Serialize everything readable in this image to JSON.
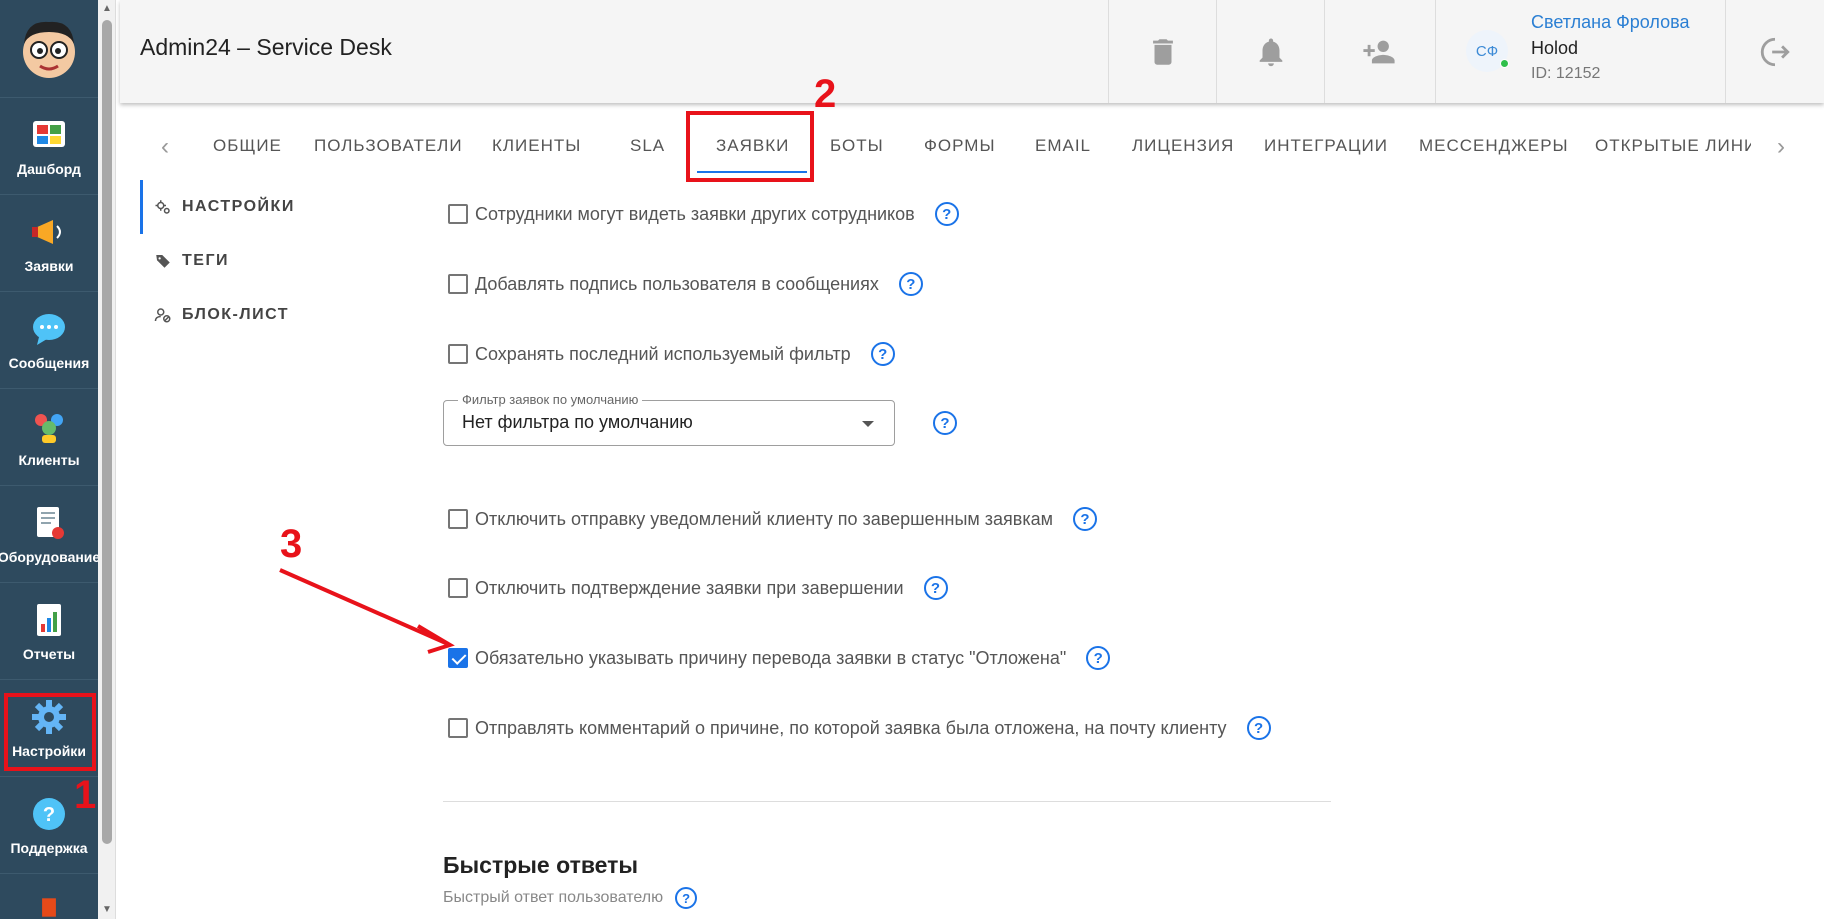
{
  "app": {
    "title": "Admin24 – Service Desk"
  },
  "leftnav": {
    "items": [
      {
        "label": "Дашборд",
        "icon": "dashboard-icon"
      },
      {
        "label": "Заявки",
        "icon": "megaphone-icon"
      },
      {
        "label": "Сообщения",
        "icon": "chat-bubble-icon"
      },
      {
        "label": "Клиенты",
        "icon": "clients-icon"
      },
      {
        "label": "Оборудование",
        "icon": "equipment-icon"
      },
      {
        "label": "Отчеты",
        "icon": "report-icon"
      },
      {
        "label": "Настройки",
        "icon": "gear-icon"
      },
      {
        "label": "Поддержка",
        "icon": "help-icon"
      }
    ],
    "active": "Настройки"
  },
  "header": {
    "user": {
      "initials": "СФ",
      "name": "Светлана Фролова",
      "company": "Holod",
      "id": "ID: 12152"
    },
    "buttons": [
      "trash-icon",
      "bell-icon",
      "add-user-icon",
      "logout-icon"
    ]
  },
  "tabs": {
    "items": [
      "ОБЩИЕ",
      "ПОЛЬЗОВАТЕЛИ",
      "КЛИЕНТЫ",
      "SLA",
      "ЗАЯВКИ",
      "БОТЫ",
      "ФОРМЫ",
      "EMAIL",
      "ЛИЦЕНЗИЯ",
      "ИНТЕГРАЦИИ",
      "МЕССЕНДЖЕРЫ",
      "ОТКРЫТЫЕ ЛИНИИ"
    ],
    "active": "ЗАЯВКИ"
  },
  "subnav": {
    "items": [
      "НАСТРОЙКИ",
      "ТЕГИ",
      "БЛОК-ЛИСТ"
    ],
    "active": "НАСТРОЙКИ"
  },
  "settings": [
    {
      "label": "Сотрудники могут видеть заявки других сотрудников",
      "checked": false
    },
    {
      "label": "Добавлять подпись пользователя в сообщениях",
      "checked": false
    },
    {
      "label": "Сохранять последний используемый фильтр",
      "checked": false
    },
    {
      "label": "Отключить отправку уведомлений клиенту по завершенным заявкам",
      "checked": false
    },
    {
      "label": "Отключить подтверждение заявки при завершении",
      "checked": false
    },
    {
      "label": "Обязательно указывать причину перевода заявки в статус \"Отложена\"",
      "checked": true
    },
    {
      "label": "Отправлять комментарий о причине, по которой заявка была отложена, на почту клиенту",
      "checked": false
    }
  ],
  "filter": {
    "legend": "Фильтр заявок по умолчанию",
    "value": "Нет фильтра по умолчанию"
  },
  "help_symbol": "?",
  "quick_answers": {
    "title": "Быстрые ответы",
    "subtitle": "Быстрый ответ пользователю"
  },
  "annotations": {
    "one": "1",
    "two": "2",
    "three": "3"
  },
  "colors": {
    "accent": "#1a73e8",
    "annotation": "#e8121a",
    "nav_bg": "#2e4a5e"
  }
}
